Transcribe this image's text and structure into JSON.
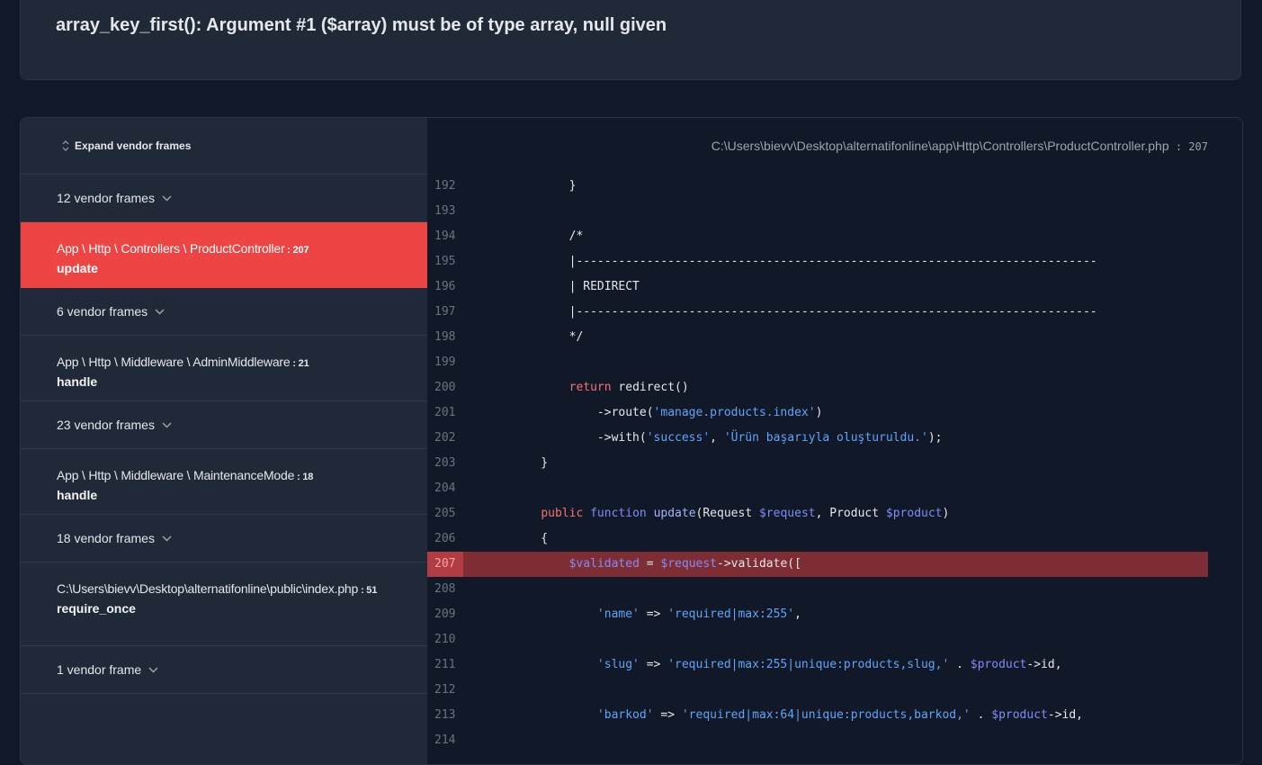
{
  "exception": {
    "message": "array_key_first(): Argument #1 ($array) must be of type array, null given"
  },
  "stack": {
    "expand_label": "Expand vendor frames",
    "frames": [
      {
        "kind": "vendor",
        "label": "12 vendor frames"
      },
      {
        "kind": "app",
        "class": "App \\ Http \\ Controllers \\ ProductController",
        "line": "207",
        "method": "update",
        "active": true
      },
      {
        "kind": "vendor",
        "label": "6 vendor frames"
      },
      {
        "kind": "app",
        "class": "App \\ Http \\ Middleware \\ AdminMiddleware",
        "line": "21",
        "method": "handle"
      },
      {
        "kind": "vendor",
        "label": "23 vendor frames"
      },
      {
        "kind": "app",
        "class": "App \\ Http \\ Middleware \\ MaintenanceMode",
        "line": "18",
        "method": "handle"
      },
      {
        "kind": "vendor",
        "label": "18 vendor frames"
      },
      {
        "kind": "app",
        "class": "C:\\Users\\bievv\\Desktop\\alternatifonline\\public\\index.php",
        "line": "51",
        "method": "require_once",
        "wrap": true
      },
      {
        "kind": "vendor",
        "label": "1 vendor frame"
      }
    ]
  },
  "code": {
    "file_path": "C:\\Users\\bievv\\Desktop\\alternatifonline\\app\\Http\\Controllers\\ProductController.php",
    "file_line": "207",
    "highlight_line": 207,
    "lines": [
      {
        "n": 192,
        "tokens": [
          [
            "        }",
            ""
          ]
        ]
      },
      {
        "n": 193,
        "tokens": []
      },
      {
        "n": 194,
        "tokens": [
          [
            "        /*",
            "c-comment"
          ]
        ]
      },
      {
        "n": 195,
        "tokens": [
          [
            "        |--------------------------------------------------------------------------",
            "c-comment"
          ]
        ]
      },
      {
        "n": 196,
        "tokens": [
          [
            "        | REDIRECT",
            "c-comment"
          ]
        ]
      },
      {
        "n": 197,
        "tokens": [
          [
            "        |--------------------------------------------------------------------------",
            "c-comment"
          ]
        ]
      },
      {
        "n": 198,
        "tokens": [
          [
            "        */",
            "c-comment"
          ]
        ]
      },
      {
        "n": 199,
        "tokens": []
      },
      {
        "n": 200,
        "tokens": [
          [
            "        ",
            ""
          ],
          [
            "return",
            "c-kw"
          ],
          [
            " redirect()",
            ""
          ]
        ]
      },
      {
        "n": 201,
        "tokens": [
          [
            "            ->route(",
            ""
          ],
          [
            "'manage.products.index'",
            "c-str"
          ],
          [
            ")",
            ""
          ]
        ]
      },
      {
        "n": 202,
        "tokens": [
          [
            "            ->with(",
            ""
          ],
          [
            "'success'",
            "c-str"
          ],
          [
            ", ",
            ""
          ],
          [
            "'Ürün başarıyla oluşturuldu.'",
            "c-str"
          ],
          [
            ");",
            ""
          ]
        ]
      },
      {
        "n": 203,
        "tokens": [
          [
            "    }",
            ""
          ]
        ]
      },
      {
        "n": 204,
        "tokens": []
      },
      {
        "n": 205,
        "tokens": [
          [
            "    ",
            ""
          ],
          [
            "public",
            "c-kw"
          ],
          [
            " ",
            ""
          ],
          [
            "function",
            "c-var"
          ],
          [
            " ",
            ""
          ],
          [
            "update",
            "c-fn"
          ],
          [
            "(Request ",
            ""
          ],
          [
            "$request",
            "c-var"
          ],
          [
            ", Product ",
            ""
          ],
          [
            "$product",
            "c-var"
          ],
          [
            ")",
            ""
          ]
        ]
      },
      {
        "n": 206,
        "tokens": [
          [
            "    {",
            ""
          ]
        ]
      },
      {
        "n": 207,
        "tokens": [
          [
            "        ",
            ""
          ],
          [
            "$validated",
            "c-var"
          ],
          [
            " = ",
            ""
          ],
          [
            "$request",
            "c-var"
          ],
          [
            "->validate([",
            ""
          ]
        ]
      },
      {
        "n": 208,
        "tokens": []
      },
      {
        "n": 209,
        "tokens": [
          [
            "            ",
            ""
          ],
          [
            "'name'",
            "c-str"
          ],
          [
            " => ",
            ""
          ],
          [
            "'required|max:255'",
            "c-str"
          ],
          [
            ",",
            ""
          ]
        ]
      },
      {
        "n": 210,
        "tokens": []
      },
      {
        "n": 211,
        "tokens": [
          [
            "            ",
            ""
          ],
          [
            "'slug'",
            "c-str"
          ],
          [
            " => ",
            ""
          ],
          [
            "'required|max:255|unique:products,slug,'",
            "c-str"
          ],
          [
            " . ",
            ""
          ],
          [
            "$product",
            "c-var"
          ],
          [
            "->id,",
            ""
          ]
        ]
      },
      {
        "n": 212,
        "tokens": []
      },
      {
        "n": 213,
        "tokens": [
          [
            "            ",
            ""
          ],
          [
            "'barkod'",
            "c-str"
          ],
          [
            " => ",
            ""
          ],
          [
            "'required|max:64|unique:products,barkod,'",
            "c-str"
          ],
          [
            " . ",
            ""
          ],
          [
            "$product",
            "c-var"
          ],
          [
            "->id,",
            ""
          ]
        ]
      },
      {
        "n": 214,
        "tokens": []
      }
    ]
  },
  "colors": {
    "accent_red": "#ef4444",
    "highlight_row": "#7f2d35",
    "background": "#111827",
    "panel": "#1f2937"
  }
}
